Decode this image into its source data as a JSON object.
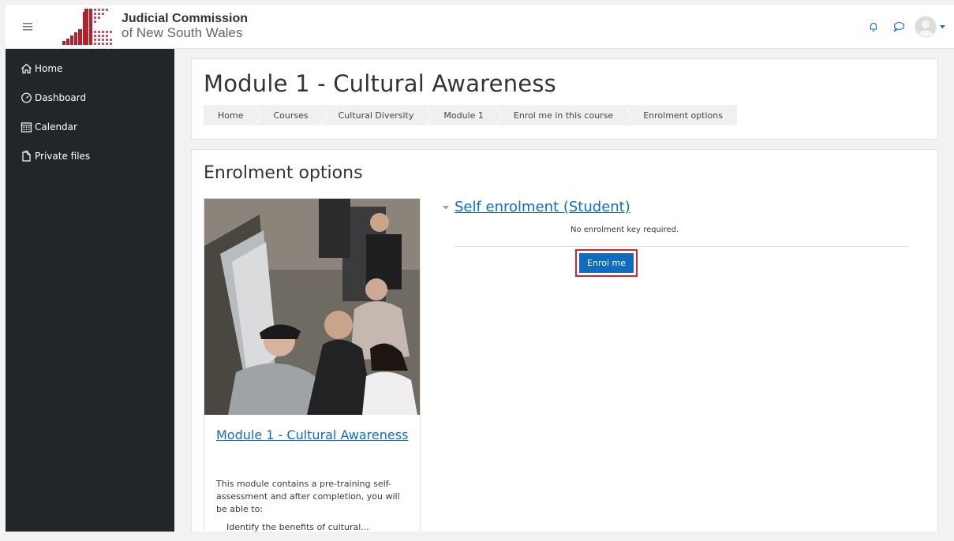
{
  "brand": {
    "line1": "Judicial Commission",
    "line2": "of New South Wales"
  },
  "nav": {
    "menu_icon": "hamburger-icon",
    "notification_icon": "bell-icon",
    "message_icon": "chat-bubble-icon",
    "user_icon": "user-avatar-icon"
  },
  "drawer": {
    "items": [
      {
        "label": "Home",
        "icon": "home-icon"
      },
      {
        "label": "Dashboard",
        "icon": "dashboard-icon"
      },
      {
        "label": "Calendar",
        "icon": "calendar-icon"
      },
      {
        "label": "Private files",
        "icon": "file-icon"
      }
    ]
  },
  "header": {
    "title": "Module 1 - Cultural Awareness",
    "breadcrumb": [
      "Home",
      "Courses",
      "Cultural Diversity",
      "Module 1",
      "Enrol me in this course",
      "Enrolment options"
    ]
  },
  "main": {
    "title": "Enrolment options",
    "course": {
      "name": "Module 1 - Cultural Awareness",
      "summary": "This module contains a pre-training self-assessment and after completion, you will be able to:",
      "bullet_partial": "Identify the benefits of cultural..."
    },
    "enrol": {
      "method": "Self enrolment (Student)",
      "key_note": "No enrolment key required.",
      "button": "Enrol me"
    }
  },
  "colors": {
    "link": "#0f6cbf",
    "drawer_bg": "#232628",
    "highlight": "#d72030",
    "logo_red": "#b5202a"
  }
}
